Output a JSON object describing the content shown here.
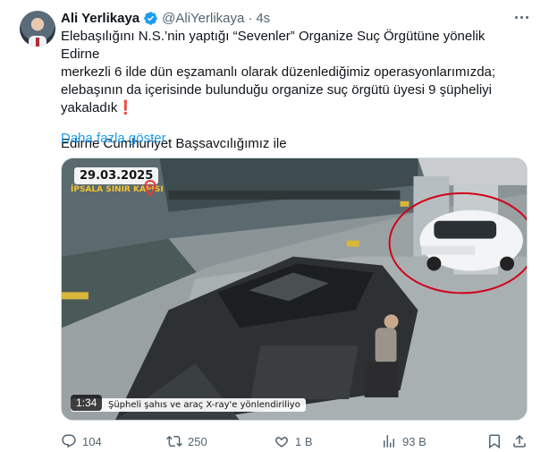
{
  "tweet": {
    "author_name": "Ali Yerlikaya",
    "handle": "@AliYerlikaya",
    "separator": "·",
    "time": "4s",
    "text_lines": [
      "Elebaşılığını N.S.’nin yaptığı “Sevenler” Organize Suç Örgütüne yönelik Edirne",
      "merkezli 6 ilde dün eşzamanlı olarak düzenlediğimiz operasyonlarımızda;",
      "elebaşının da içerisinde bulunduğu organize suç örgütü üyesi 9 şüpheliyi",
      "yakaladık"
    ],
    "text_line_2": "Edirne Cumhuriyet Başsavcılığımız ile",
    "show_more": "Daha fazla göster",
    "emoji": "❗"
  },
  "media": {
    "date_overlay": "29.03.2025",
    "location_overlay": "İPSALA SINIR KAPISI",
    "duration": "1:34",
    "caption": "Şüpheli şahıs ve araç X-ray'e yönlendiriliyo",
    "highlight_color": "#d0021b"
  },
  "actions": {
    "replies": "104",
    "reposts": "250",
    "likes": "1 B",
    "views": "93 B"
  },
  "colors": {
    "text": "#0f1419",
    "muted": "#536471",
    "link": "#1d9bf0",
    "verified": "#1d9bf0"
  }
}
